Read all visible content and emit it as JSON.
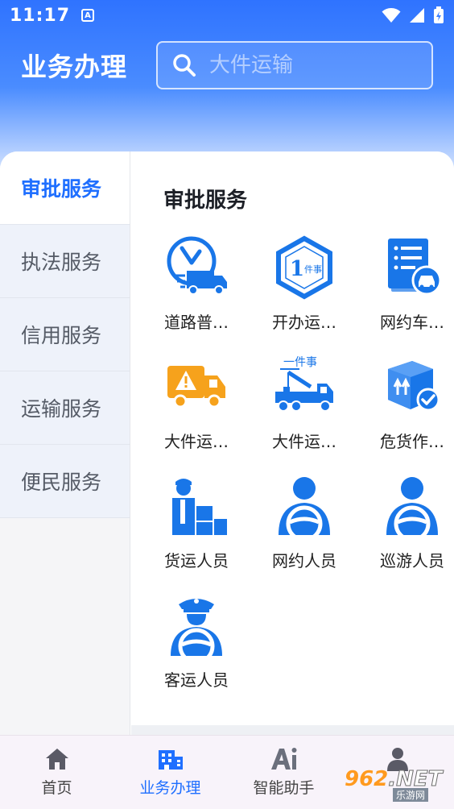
{
  "status_bar": {
    "time": "11:17",
    "notif_letter": "A"
  },
  "header": {
    "title": "业务办理",
    "search_placeholder": "大件运输"
  },
  "sidebar": {
    "items": [
      {
        "label": "审批服务",
        "active": true
      },
      {
        "label": "执法服务",
        "active": false
      },
      {
        "label": "信用服务",
        "active": false
      },
      {
        "label": "运输服务",
        "active": false
      },
      {
        "label": "便民服务",
        "active": false
      }
    ]
  },
  "content": {
    "section_title": "审批服务",
    "items": [
      {
        "label": "道路普…",
        "icon": "clock-truck-icon"
      },
      {
        "label": "开办运…",
        "icon": "one-thing-hexagon-icon"
      },
      {
        "label": "网约车…",
        "icon": "document-car-icon"
      },
      {
        "label": "大件运…",
        "icon": "warning-truck-icon"
      },
      {
        "label": "大件运…",
        "icon": "crane-truck-icon"
      },
      {
        "label": "危货作…",
        "icon": "hazard-box-icon"
      },
      {
        "label": "货运人员",
        "icon": "cargo-worker-icon"
      },
      {
        "label": "网约人员",
        "icon": "driver-icon"
      },
      {
        "label": "巡游人员",
        "icon": "driver-icon"
      },
      {
        "label": "客运人员",
        "icon": "bus-driver-icon"
      }
    ],
    "one_thing_badge": "1",
    "one_thing_text": "件事",
    "crane_banner_text": "一件事"
  },
  "tabbar": {
    "tabs": [
      {
        "label": "首页",
        "icon": "home-icon",
        "active": false
      },
      {
        "label": "业务办理",
        "icon": "building-icon",
        "active": true
      },
      {
        "label": "智能助手",
        "icon": "ai-icon",
        "active": false
      },
      {
        "label": "",
        "icon": "person-icon",
        "active": false
      }
    ]
  },
  "watermark": {
    "logo": "962",
    "logo_suffix": ".NET",
    "subtitle": "乐游网"
  },
  "colors": {
    "accent": "#1f6fff",
    "icon_blue": "#1976e8",
    "icon_orange": "#f6a21c",
    "header_top": "#2f73ff"
  }
}
